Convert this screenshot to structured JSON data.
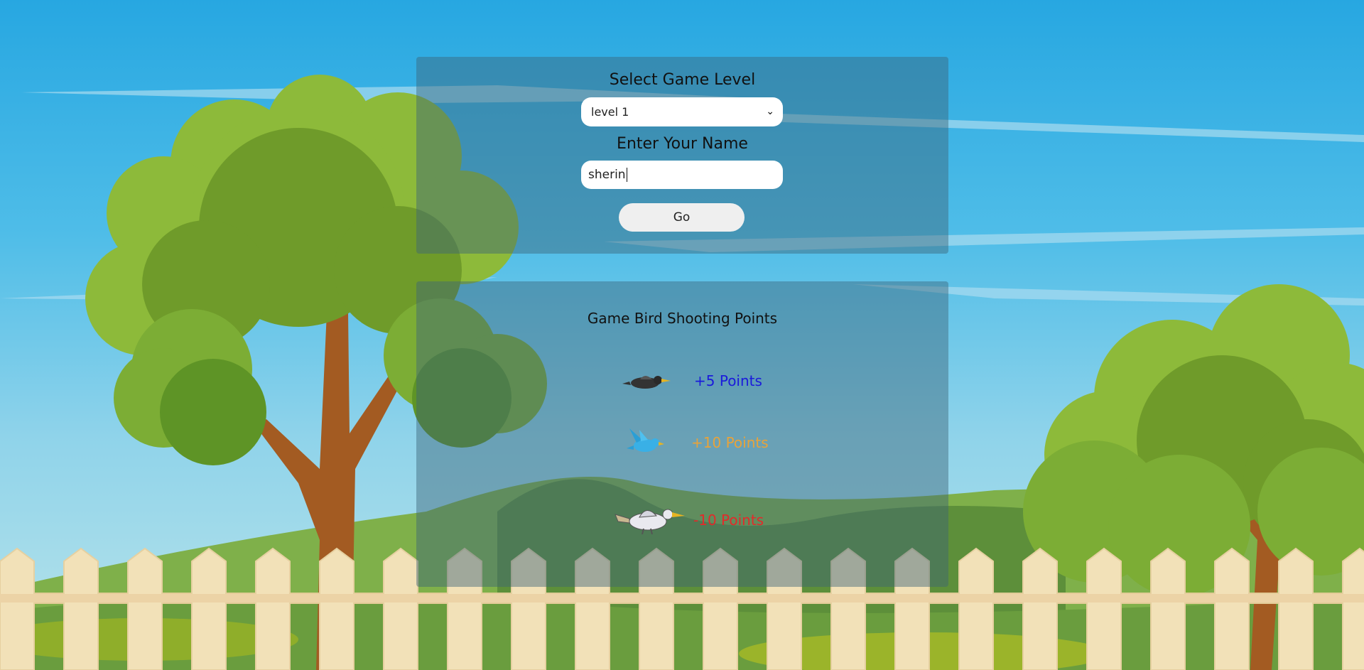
{
  "level_panel": {
    "select_label": "Select Game Level",
    "selected_level": "level 1",
    "name_label": "Enter Your Name",
    "name_value": "sherin",
    "go_label": "Go"
  },
  "points_panel": {
    "title": "Game Bird Shooting Points",
    "rows": [
      {
        "bird": "black-bird-icon",
        "label": "+5 Points",
        "color": "#1a1adb"
      },
      {
        "bird": "blue-bird-icon",
        "label": "+10 Points",
        "color": "#e8a33a"
      },
      {
        "bird": "white-bird-icon",
        "label": "-10 Points",
        "color": "#e32a2a"
      }
    ]
  },
  "colors": {
    "sky": "#27a7e1",
    "panel": "rgba(60,100,120,0.45)",
    "fence": "#f2e1b8"
  }
}
